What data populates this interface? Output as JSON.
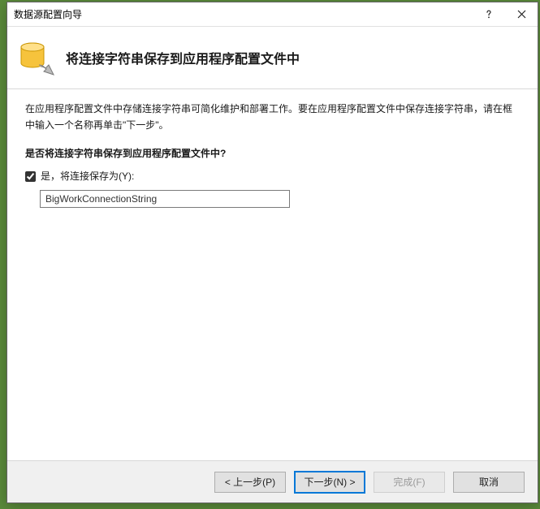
{
  "window": {
    "title": "数据源配置向导"
  },
  "header": {
    "title": "将连接字符串保存到应用程序配置文件中"
  },
  "content": {
    "description": "在应用程序配置文件中存储连接字符串可简化维护和部署工作。要在应用程序配置文件中保存连接字符串，请在框中输入一个名称再单击\"下一步\"。",
    "question": "是否将连接字符串保存到应用程序配置文件中?",
    "checkbox": {
      "checked": true,
      "label": "是，将连接保存为(Y):"
    },
    "connectionName": "BigWorkConnectionString"
  },
  "footer": {
    "back": "< 上一步(P)",
    "next": "下一步(N) >",
    "finish": "完成(F)",
    "cancel": "取消"
  }
}
